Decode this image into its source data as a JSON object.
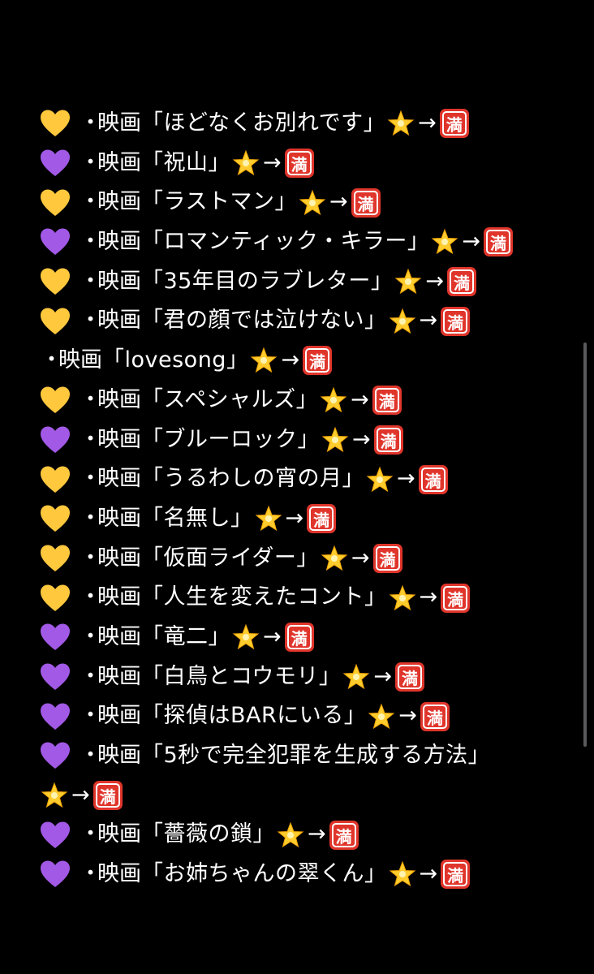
{
  "colors": {
    "background": "#000000",
    "text": "#ffffff",
    "heart_yellow": "#ffc83d",
    "heart_purple": "#a259e6",
    "star": "#ffcc2e",
    "badge_red": "#e0352b"
  },
  "common": {
    "bullet": "・",
    "prefix": "映画",
    "arrow": "→",
    "badge": "満"
  },
  "items": [
    {
      "heart": "yellow",
      "title": "「ほどなくお別れです」"
    },
    {
      "heart": "purple",
      "title": "「祝山」"
    },
    {
      "heart": "yellow",
      "title": "「ラストマン」"
    },
    {
      "heart": "purple",
      "title": "「ロマンティック・キラー」"
    },
    {
      "heart": "yellow",
      "title": "「35年目のラブレター」"
    },
    {
      "heart": "yellow",
      "title": "「君の顔では泣けない」"
    },
    {
      "heart": "none",
      "title": "「lovesong」"
    },
    {
      "heart": "yellow",
      "title": "「スペシャルズ」"
    },
    {
      "heart": "purple",
      "title": "「ブルーロック」"
    },
    {
      "heart": "yellow",
      "title": "「うるわしの宵の月」"
    },
    {
      "heart": "yellow",
      "title": "「名無し」"
    },
    {
      "heart": "yellow",
      "title": "「仮面ライダー」"
    },
    {
      "heart": "yellow",
      "title": "「人生を変えたコント」"
    },
    {
      "heart": "purple",
      "title": "「竜二」"
    },
    {
      "heart": "purple",
      "title": "「白鳥とコウモリ」"
    },
    {
      "heart": "purple",
      "title": "「探偵はBARにいる」"
    },
    {
      "heart": "purple",
      "title": "「5秒で完全犯罪を生成する方法」"
    },
    {
      "heart": "purple",
      "title": "「薔薇の鎖」"
    },
    {
      "heart": "purple",
      "title": "「お姉ちゃんの翠くん」"
    }
  ]
}
